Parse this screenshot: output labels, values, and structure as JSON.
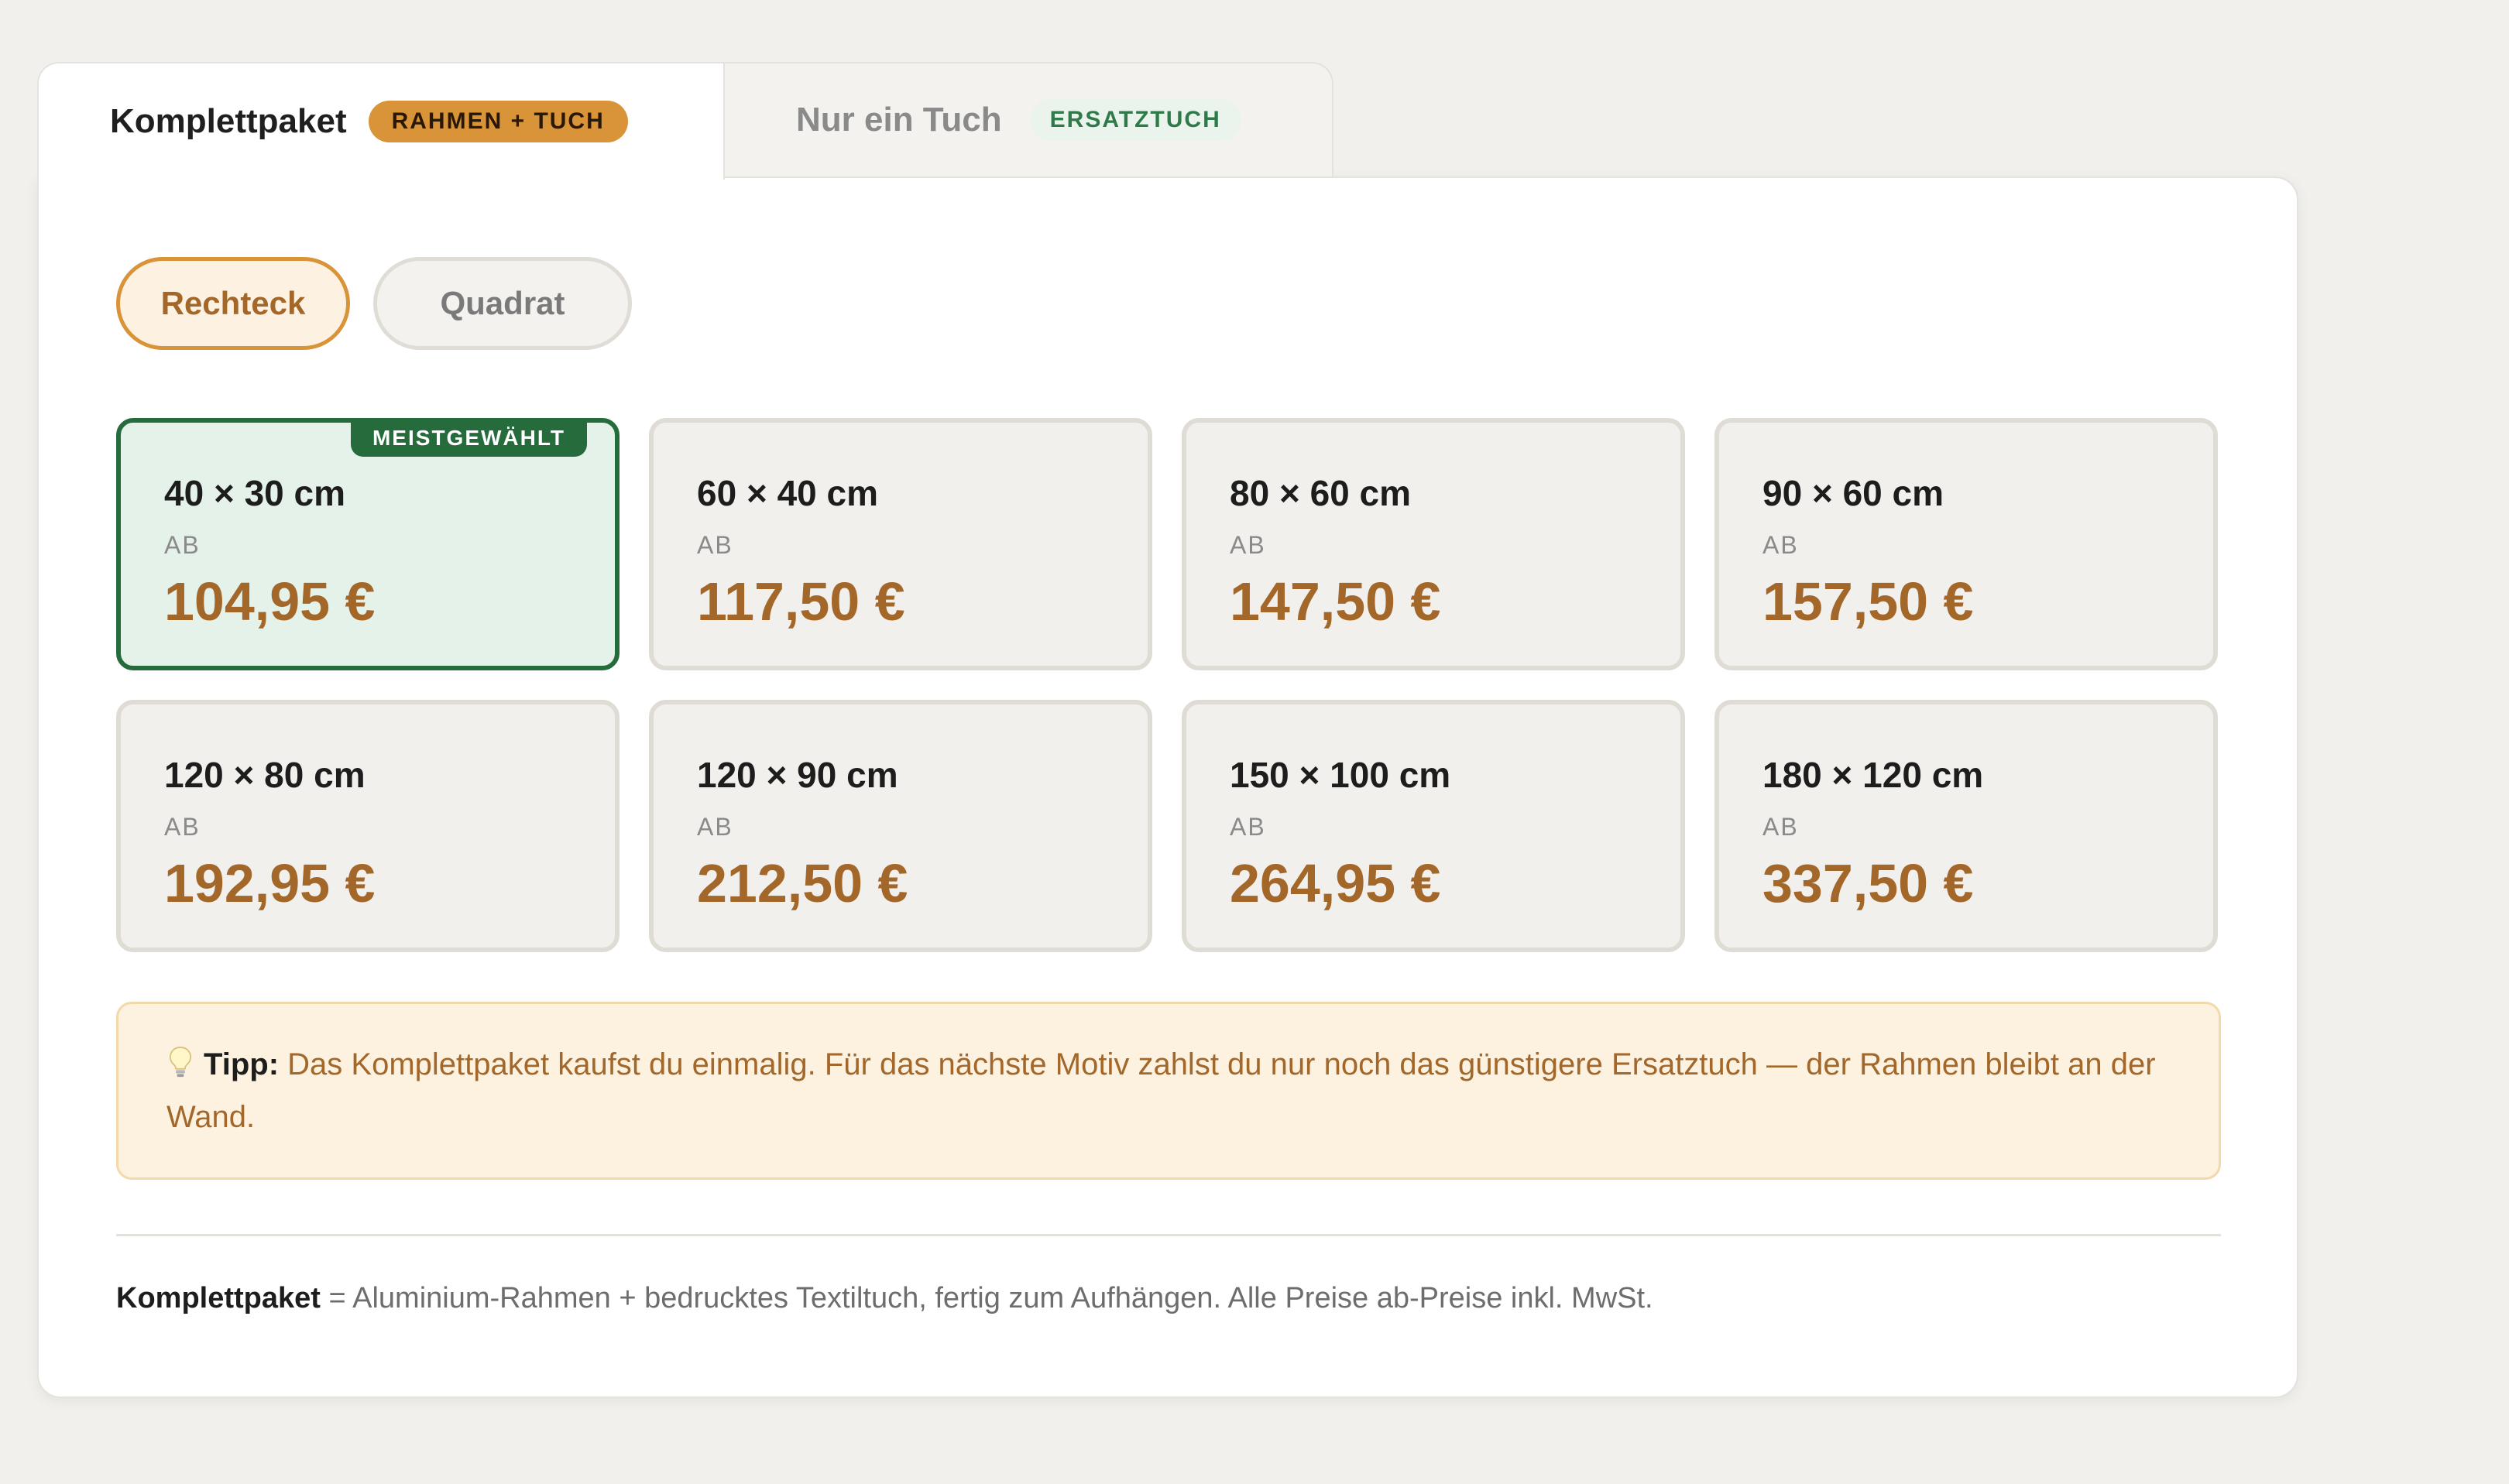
{
  "tabs": {
    "active": {
      "label": "Komplettpaket",
      "badge": "RAHMEN + TUCH"
    },
    "inactive": {
      "label": "Nur ein Tuch",
      "badge": "ERSATZTUCH"
    }
  },
  "shape_toggle": {
    "selected": "Rechteck",
    "other": "Quadrat"
  },
  "sizes": [
    {
      "size": "40 × 30 cm",
      "ab": "AB",
      "price": "104,95 €",
      "badge": "MEISTGEWÄHLT"
    },
    {
      "size": "60 × 40 cm",
      "ab": "AB",
      "price": "117,50 €"
    },
    {
      "size": "80 × 60 cm",
      "ab": "AB",
      "price": "147,50 €"
    },
    {
      "size": "90 × 60 cm",
      "ab": "AB",
      "price": "157,50 €"
    },
    {
      "size": "120 × 80 cm",
      "ab": "AB",
      "price": "192,95 €"
    },
    {
      "size": "120 × 90 cm",
      "ab": "AB",
      "price": "212,50 €"
    },
    {
      "size": "150 × 100 cm",
      "ab": "AB",
      "price": "264,95 €"
    },
    {
      "size": "180 × 120 cm",
      "ab": "AB",
      "price": "337,50 €"
    }
  ],
  "tip": {
    "icon": "lightbulb-icon",
    "title": "Tipp:",
    "text": "Das Komplettpaket kaufst du einmalig. Für das nächste Motiv zahlst du nur noch das günstigere Ersatztuch — der Rahmen bleibt an der Wand."
  },
  "footnote": {
    "strong": "Komplettpaket",
    "text": " = Aluminium-Rahmen + bedrucktes Textiltuch, fertig zum Aufhängen. Alle Preise ab-Preise inkl. MwSt."
  },
  "colors": {
    "accent": "#a3672a",
    "accent_badge": "#d9943a",
    "selected_border": "#256b3c",
    "selected_bg": "#e4f2ea",
    "tip_bg": "#fdf2e0"
  }
}
